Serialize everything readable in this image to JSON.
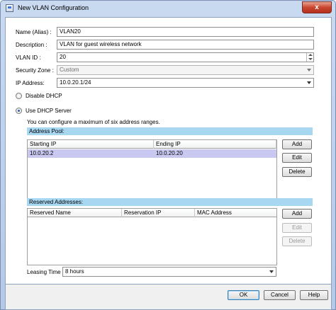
{
  "window": {
    "title": "New VLAN Configuration",
    "close_label": "x"
  },
  "form": {
    "name_label": "Name (Alias) :",
    "name_value": "VLAN20",
    "description_label": "Description :",
    "description_value": "VLAN for guest wireless network",
    "vlan_id_label": "VLAN ID :",
    "vlan_id_value": "20",
    "security_zone_label": "Security Zone :",
    "security_zone_value": "Custom",
    "ip_address_label": "IP Address:",
    "ip_address_value": "10.0.20.1/24"
  },
  "dhcp": {
    "disable_label": "Disable DHCP",
    "use_server_label": "Use DHCP Server",
    "selected": "use_server",
    "hint": "You can configure a maximum of six address ranges."
  },
  "address_pool": {
    "title": "Address Pool:",
    "columns": [
      "Starting IP",
      "Ending IP"
    ],
    "rows": [
      {
        "starting_ip": "10.0.20.2",
        "ending_ip": "10.0.20.20"
      }
    ],
    "buttons": {
      "add": "Add",
      "edit": "Edit",
      "delete": "Delete"
    }
  },
  "reserved": {
    "title": "Reserved Addresses:",
    "columns": [
      "Reserved Name",
      "Reservation IP",
      "MAC Address"
    ],
    "buttons": {
      "add": "Add",
      "edit": "Edit",
      "delete": "Delete"
    }
  },
  "leasing": {
    "label": "Leasing Time",
    "value": "8 hours"
  },
  "footer": {
    "ok": "OK",
    "cancel": "Cancel",
    "help": "Help"
  },
  "colors": {
    "section_bar": "#a8d7f2",
    "selected_row": "#c9c8f0",
    "title_bar": "#c9daf0"
  }
}
